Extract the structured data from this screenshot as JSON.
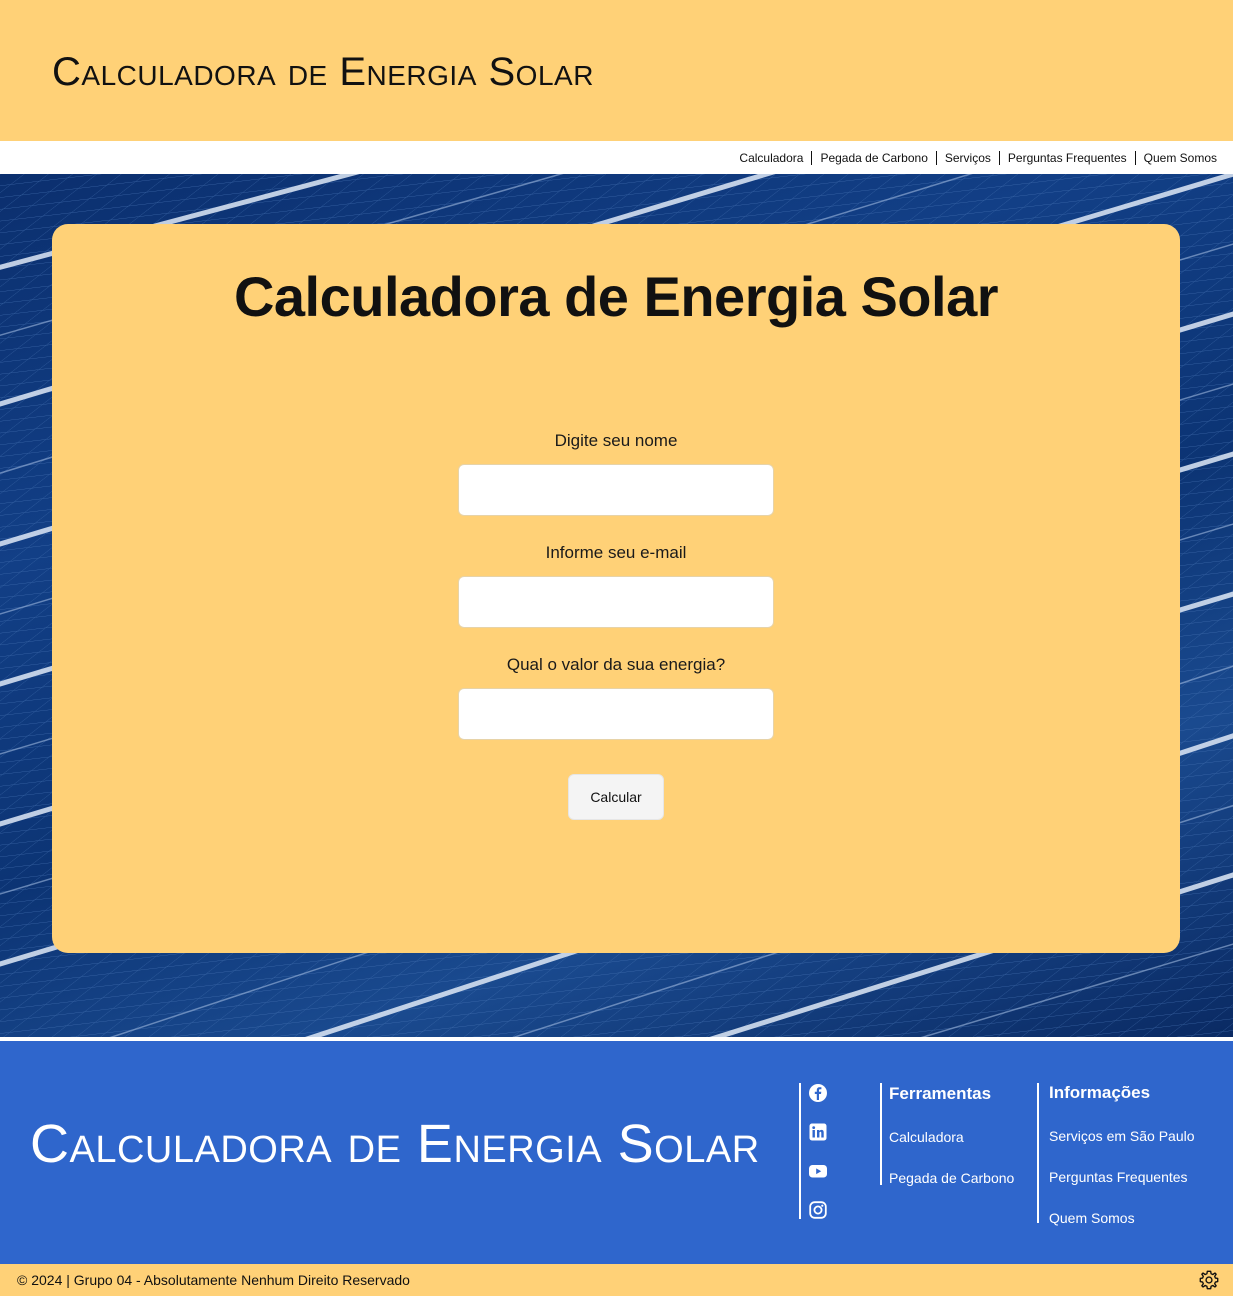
{
  "header": {
    "title": "Calculadora de Energia Solar"
  },
  "nav": {
    "items": [
      "Calculadora",
      "Pegada de Carbono",
      "Serviços",
      "Perguntas Frequentes",
      "Quem Somos"
    ]
  },
  "form": {
    "title": "Calculadora de Energia Solar",
    "fields": [
      {
        "label": "Digite seu nome",
        "value": ""
      },
      {
        "label": "Informe seu e-mail",
        "value": ""
      },
      {
        "label": "Qual o valor da sua energia?",
        "value": ""
      }
    ],
    "submit_label": "Calcular"
  },
  "footer": {
    "title": "Calculadora de Energia Solar",
    "social_icons": [
      "facebook-icon",
      "linkedin-icon",
      "youtube-icon",
      "instagram-icon"
    ],
    "columns": [
      {
        "heading": "Ferramentas",
        "links": [
          "Calculadora",
          "Pegada de Carbono"
        ]
      },
      {
        "heading": "Informações",
        "links": [
          "Serviços em São Paulo",
          "Perguntas Frequentes",
          "Quem Somos"
        ]
      }
    ]
  },
  "bottom_bar": {
    "copyright": "© 2024 | Grupo 04 - Absolutamente Nenhum Direito Reservado",
    "settings_icon": "gear-icon"
  },
  "colors": {
    "accent_yellow": "#ffd177",
    "footer_blue": "#2f66cc",
    "panel_blue": "#0c3474"
  }
}
